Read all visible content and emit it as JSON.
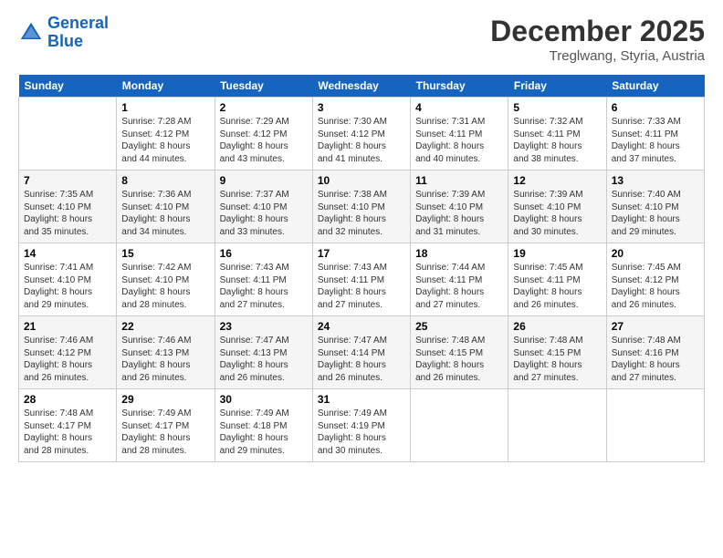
{
  "header": {
    "logo_line1": "General",
    "logo_line2": "Blue",
    "month": "December 2025",
    "location": "Treglwang, Styria, Austria"
  },
  "days_of_week": [
    "Sunday",
    "Monday",
    "Tuesday",
    "Wednesday",
    "Thursday",
    "Friday",
    "Saturday"
  ],
  "weeks": [
    [
      {
        "num": "",
        "info": ""
      },
      {
        "num": "1",
        "info": "Sunrise: 7:28 AM\nSunset: 4:12 PM\nDaylight: 8 hours\nand 44 minutes."
      },
      {
        "num": "2",
        "info": "Sunrise: 7:29 AM\nSunset: 4:12 PM\nDaylight: 8 hours\nand 43 minutes."
      },
      {
        "num": "3",
        "info": "Sunrise: 7:30 AM\nSunset: 4:12 PM\nDaylight: 8 hours\nand 41 minutes."
      },
      {
        "num": "4",
        "info": "Sunrise: 7:31 AM\nSunset: 4:11 PM\nDaylight: 8 hours\nand 40 minutes."
      },
      {
        "num": "5",
        "info": "Sunrise: 7:32 AM\nSunset: 4:11 PM\nDaylight: 8 hours\nand 38 minutes."
      },
      {
        "num": "6",
        "info": "Sunrise: 7:33 AM\nSunset: 4:11 PM\nDaylight: 8 hours\nand 37 minutes."
      }
    ],
    [
      {
        "num": "7",
        "info": "Sunrise: 7:35 AM\nSunset: 4:10 PM\nDaylight: 8 hours\nand 35 minutes."
      },
      {
        "num": "8",
        "info": "Sunrise: 7:36 AM\nSunset: 4:10 PM\nDaylight: 8 hours\nand 34 minutes."
      },
      {
        "num": "9",
        "info": "Sunrise: 7:37 AM\nSunset: 4:10 PM\nDaylight: 8 hours\nand 33 minutes."
      },
      {
        "num": "10",
        "info": "Sunrise: 7:38 AM\nSunset: 4:10 PM\nDaylight: 8 hours\nand 32 minutes."
      },
      {
        "num": "11",
        "info": "Sunrise: 7:39 AM\nSunset: 4:10 PM\nDaylight: 8 hours\nand 31 minutes."
      },
      {
        "num": "12",
        "info": "Sunrise: 7:39 AM\nSunset: 4:10 PM\nDaylight: 8 hours\nand 30 minutes."
      },
      {
        "num": "13",
        "info": "Sunrise: 7:40 AM\nSunset: 4:10 PM\nDaylight: 8 hours\nand 29 minutes."
      }
    ],
    [
      {
        "num": "14",
        "info": "Sunrise: 7:41 AM\nSunset: 4:10 PM\nDaylight: 8 hours\nand 29 minutes."
      },
      {
        "num": "15",
        "info": "Sunrise: 7:42 AM\nSunset: 4:10 PM\nDaylight: 8 hours\nand 28 minutes."
      },
      {
        "num": "16",
        "info": "Sunrise: 7:43 AM\nSunset: 4:11 PM\nDaylight: 8 hours\nand 27 minutes."
      },
      {
        "num": "17",
        "info": "Sunrise: 7:43 AM\nSunset: 4:11 PM\nDaylight: 8 hours\nand 27 minutes."
      },
      {
        "num": "18",
        "info": "Sunrise: 7:44 AM\nSunset: 4:11 PM\nDaylight: 8 hours\nand 27 minutes."
      },
      {
        "num": "19",
        "info": "Sunrise: 7:45 AM\nSunset: 4:11 PM\nDaylight: 8 hours\nand 26 minutes."
      },
      {
        "num": "20",
        "info": "Sunrise: 7:45 AM\nSunset: 4:12 PM\nDaylight: 8 hours\nand 26 minutes."
      }
    ],
    [
      {
        "num": "21",
        "info": "Sunrise: 7:46 AM\nSunset: 4:12 PM\nDaylight: 8 hours\nand 26 minutes."
      },
      {
        "num": "22",
        "info": "Sunrise: 7:46 AM\nSunset: 4:13 PM\nDaylight: 8 hours\nand 26 minutes."
      },
      {
        "num": "23",
        "info": "Sunrise: 7:47 AM\nSunset: 4:13 PM\nDaylight: 8 hours\nand 26 minutes."
      },
      {
        "num": "24",
        "info": "Sunrise: 7:47 AM\nSunset: 4:14 PM\nDaylight: 8 hours\nand 26 minutes."
      },
      {
        "num": "25",
        "info": "Sunrise: 7:48 AM\nSunset: 4:15 PM\nDaylight: 8 hours\nand 26 minutes."
      },
      {
        "num": "26",
        "info": "Sunrise: 7:48 AM\nSunset: 4:15 PM\nDaylight: 8 hours\nand 27 minutes."
      },
      {
        "num": "27",
        "info": "Sunrise: 7:48 AM\nSunset: 4:16 PM\nDaylight: 8 hours\nand 27 minutes."
      }
    ],
    [
      {
        "num": "28",
        "info": "Sunrise: 7:48 AM\nSunset: 4:17 PM\nDaylight: 8 hours\nand 28 minutes."
      },
      {
        "num": "29",
        "info": "Sunrise: 7:49 AM\nSunset: 4:17 PM\nDaylight: 8 hours\nand 28 minutes."
      },
      {
        "num": "30",
        "info": "Sunrise: 7:49 AM\nSunset: 4:18 PM\nDaylight: 8 hours\nand 29 minutes."
      },
      {
        "num": "31",
        "info": "Sunrise: 7:49 AM\nSunset: 4:19 PM\nDaylight: 8 hours\nand 30 minutes."
      },
      {
        "num": "",
        "info": ""
      },
      {
        "num": "",
        "info": ""
      },
      {
        "num": "",
        "info": ""
      }
    ]
  ]
}
